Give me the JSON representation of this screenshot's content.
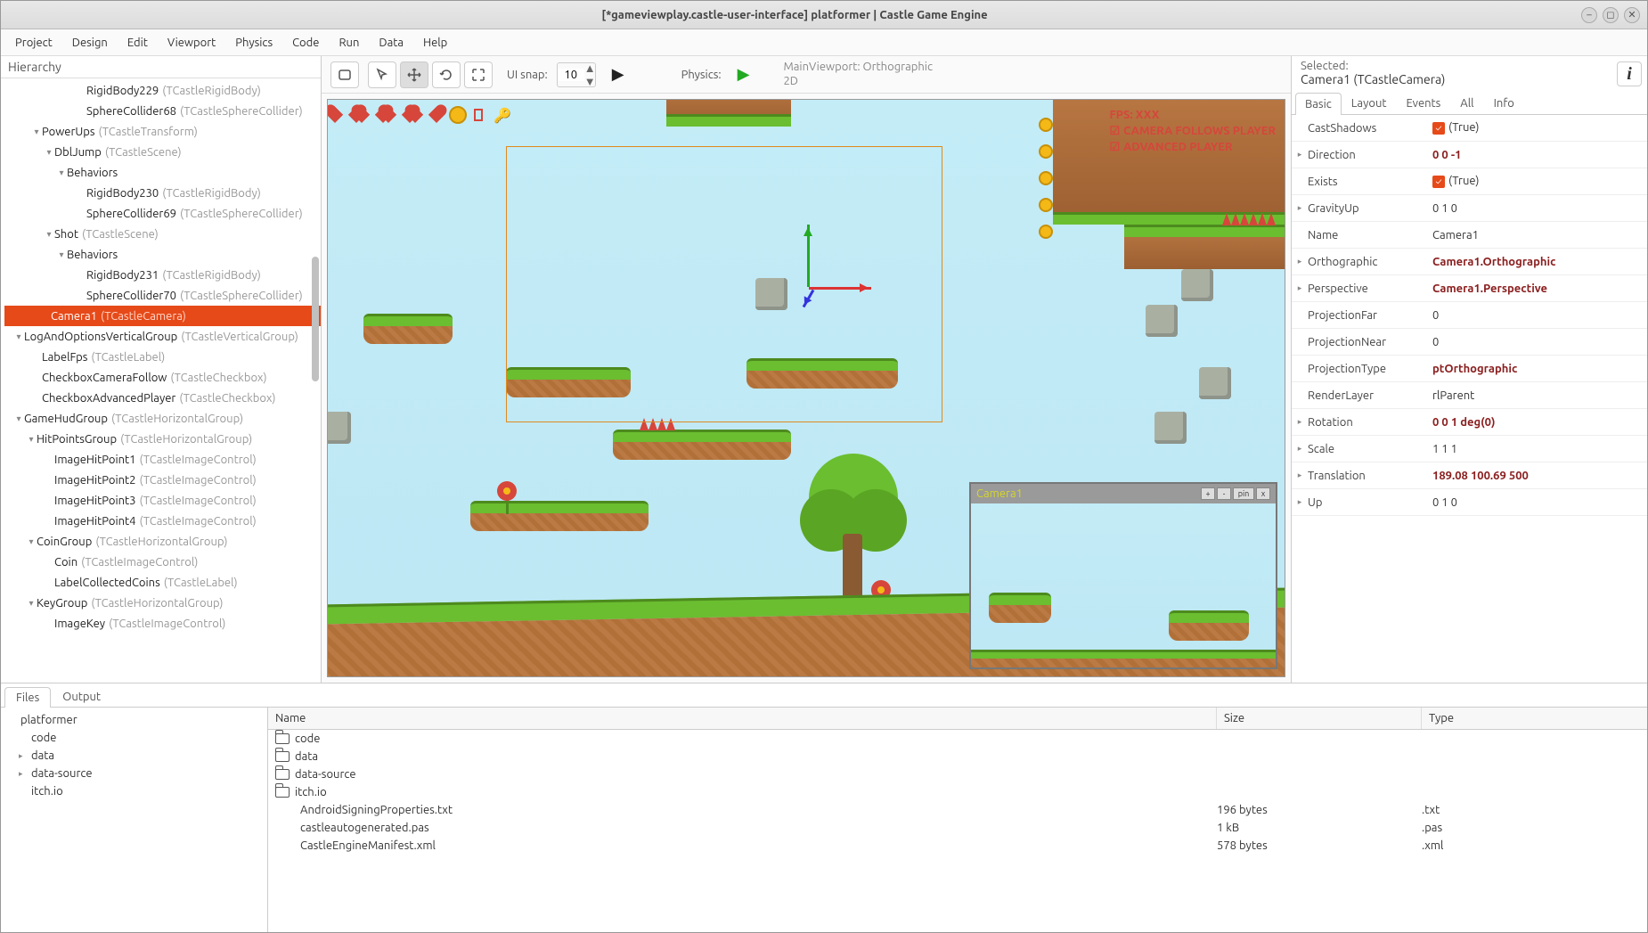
{
  "title": "[*gameviewplay.castle-user-interface] platformer | Castle Game Engine",
  "menus": [
    "Project",
    "Design",
    "Edit",
    "Viewport",
    "Physics",
    "Code",
    "Run",
    "Data",
    "Help"
  ],
  "hierarchy_label": "Hierarchy",
  "hierarchy": [
    {
      "indent": 80,
      "tw": "",
      "name": "RigidBody229",
      "cls": "(TCastleRigidBody)",
      "sel": false
    },
    {
      "indent": 80,
      "tw": "",
      "name": "SphereCollider68",
      "cls": "(TCastleSphereCollider)",
      "sel": false
    },
    {
      "indent": 30,
      "tw": "▾",
      "name": "PowerUps",
      "cls": "(TCastleTransform)",
      "sel": false
    },
    {
      "indent": 44,
      "tw": "▾",
      "name": "DblJump",
      "cls": "(TCastleScene)",
      "sel": false
    },
    {
      "indent": 58,
      "tw": "▾",
      "name": "Behaviors",
      "cls": "",
      "sel": false
    },
    {
      "indent": 80,
      "tw": "",
      "name": "RigidBody230",
      "cls": "(TCastleRigidBody)",
      "sel": false
    },
    {
      "indent": 80,
      "tw": "",
      "name": "SphereCollider69",
      "cls": "(TCastleSphereCollider)",
      "sel": false
    },
    {
      "indent": 44,
      "tw": "▾",
      "name": "Shot",
      "cls": "(TCastleScene)",
      "sel": false
    },
    {
      "indent": 58,
      "tw": "▾",
      "name": "Behaviors",
      "cls": "",
      "sel": false
    },
    {
      "indent": 80,
      "tw": "",
      "name": "RigidBody231",
      "cls": "(TCastleRigidBody)",
      "sel": false
    },
    {
      "indent": 80,
      "tw": "",
      "name": "SphereCollider70",
      "cls": "(TCastleSphereCollider)",
      "sel": false
    },
    {
      "indent": 40,
      "tw": "",
      "name": "Camera1",
      "cls": "(TCastleCamera)",
      "sel": true
    },
    {
      "indent": 10,
      "tw": "▾",
      "name": "LogAndOptionsVerticalGroup",
      "cls": "(TCastleVerticalGroup)",
      "sel": false
    },
    {
      "indent": 30,
      "tw": "",
      "name": "LabelFps",
      "cls": "(TCastleLabel)",
      "sel": false
    },
    {
      "indent": 30,
      "tw": "",
      "name": "CheckboxCameraFollow",
      "cls": "(TCastleCheckbox)",
      "sel": false
    },
    {
      "indent": 30,
      "tw": "",
      "name": "CheckboxAdvancedPlayer",
      "cls": "(TCastleCheckbox)",
      "sel": false
    },
    {
      "indent": 10,
      "tw": "▾",
      "name": "GameHudGroup",
      "cls": "(TCastleHorizontalGroup)",
      "sel": false
    },
    {
      "indent": 24,
      "tw": "▾",
      "name": "HitPointsGroup",
      "cls": "(TCastleHorizontalGroup)",
      "sel": false
    },
    {
      "indent": 44,
      "tw": "",
      "name": "ImageHitPoint1",
      "cls": "(TCastleImageControl)",
      "sel": false
    },
    {
      "indent": 44,
      "tw": "",
      "name": "ImageHitPoint2",
      "cls": "(TCastleImageControl)",
      "sel": false
    },
    {
      "indent": 44,
      "tw": "",
      "name": "ImageHitPoint3",
      "cls": "(TCastleImageControl)",
      "sel": false
    },
    {
      "indent": 44,
      "tw": "",
      "name": "ImageHitPoint4",
      "cls": "(TCastleImageControl)",
      "sel": false
    },
    {
      "indent": 24,
      "tw": "▾",
      "name": "CoinGroup",
      "cls": "(TCastleHorizontalGroup)",
      "sel": false
    },
    {
      "indent": 44,
      "tw": "",
      "name": "Coin",
      "cls": "(TCastleImageControl)",
      "sel": false
    },
    {
      "indent": 44,
      "tw": "",
      "name": "LabelCollectedCoins",
      "cls": "(TCastleLabel)",
      "sel": false
    },
    {
      "indent": 24,
      "tw": "▾",
      "name": "KeyGroup",
      "cls": "(TCastleHorizontalGroup)",
      "sel": false
    },
    {
      "indent": 44,
      "tw": "",
      "name": "ImageKey",
      "cls": "(TCastleImageControl)",
      "sel": false
    }
  ],
  "toolbar": {
    "snap_label": "UI snap:",
    "snap_value": "10",
    "physics_label": "Physics:",
    "vpinfo1": "MainViewport: Orthographic",
    "vpinfo2": "2D"
  },
  "hud": {
    "fps": "FPS: XXX",
    "cam": "CAMERA FOLLOWS PLAYER",
    "adv": "ADVANCED PLAYER"
  },
  "preview": {
    "title": "Camera1",
    "btns": [
      "+",
      "-",
      "pin",
      "x"
    ]
  },
  "inspector": {
    "selected_label": "Selected:",
    "selected_value": "Camera1 (TCastleCamera)",
    "tabs": [
      "Basic",
      "Layout",
      "Events",
      "All",
      "Info"
    ],
    "props": [
      {
        "exp": "",
        "name": "CastShadows",
        "val": "(True)",
        "bold": false,
        "check": true
      },
      {
        "exp": "▸",
        "name": "Direction",
        "val": "0 0 -1",
        "bold": true,
        "check": false
      },
      {
        "exp": "",
        "name": "Exists",
        "val": "(True)",
        "bold": false,
        "check": true
      },
      {
        "exp": "▸",
        "name": "GravityUp",
        "val": "0 1 0",
        "bold": false,
        "check": false
      },
      {
        "exp": "",
        "name": "Name",
        "val": "Camera1",
        "bold": false,
        "check": false
      },
      {
        "exp": "▸",
        "name": "Orthographic",
        "val": "Camera1.Orthographic",
        "bold": true,
        "check": false
      },
      {
        "exp": "▸",
        "name": "Perspective",
        "val": "Camera1.Perspective",
        "bold": true,
        "check": false
      },
      {
        "exp": "",
        "name": "ProjectionFar",
        "val": "0",
        "bold": false,
        "check": false
      },
      {
        "exp": "",
        "name": "ProjectionNear",
        "val": "0",
        "bold": false,
        "check": false
      },
      {
        "exp": "",
        "name": "ProjectionType",
        "val": "ptOrthographic",
        "bold": true,
        "check": false
      },
      {
        "exp": "",
        "name": "RenderLayer",
        "val": "rlParent",
        "bold": false,
        "check": false
      },
      {
        "exp": "▸",
        "name": "Rotation",
        "val": "0 0 1 deg(0)",
        "bold": true,
        "check": false
      },
      {
        "exp": "▸",
        "name": "Scale",
        "val": "1 1 1",
        "bold": false,
        "check": false
      },
      {
        "exp": "▸",
        "name": "Translation",
        "val": "189.08 100.69 500",
        "bold": true,
        "check": false
      },
      {
        "exp": "▸",
        "name": "Up",
        "val": "0 1 0",
        "bold": false,
        "check": false
      }
    ]
  },
  "bottom": {
    "tabs": [
      "Files",
      "Output"
    ],
    "dirtree": [
      {
        "indent": 0,
        "tw": "",
        "name": "platformer"
      },
      {
        "indent": 12,
        "tw": "",
        "name": "code"
      },
      {
        "indent": 12,
        "tw": "▸",
        "name": "data"
      },
      {
        "indent": 12,
        "tw": "▸",
        "name": "data-source"
      },
      {
        "indent": 12,
        "tw": "",
        "name": "itch.io"
      }
    ],
    "headers": {
      "name": "Name",
      "size": "Size",
      "type": "Type"
    },
    "files": [
      {
        "folder": true,
        "name": "code",
        "size": "",
        "type": ""
      },
      {
        "folder": true,
        "name": "data",
        "size": "",
        "type": ""
      },
      {
        "folder": true,
        "name": "data-source",
        "size": "",
        "type": ""
      },
      {
        "folder": true,
        "name": "itch.io",
        "size": "",
        "type": ""
      },
      {
        "folder": false,
        "name": "AndroidSigningProperties.txt",
        "size": "196 bytes",
        "type": ".txt"
      },
      {
        "folder": false,
        "name": "castleautogenerated.pas",
        "size": "1 kB",
        "type": ".pas"
      },
      {
        "folder": false,
        "name": "CastleEngineManifest.xml",
        "size": "578 bytes",
        "type": ".xml"
      }
    ]
  }
}
